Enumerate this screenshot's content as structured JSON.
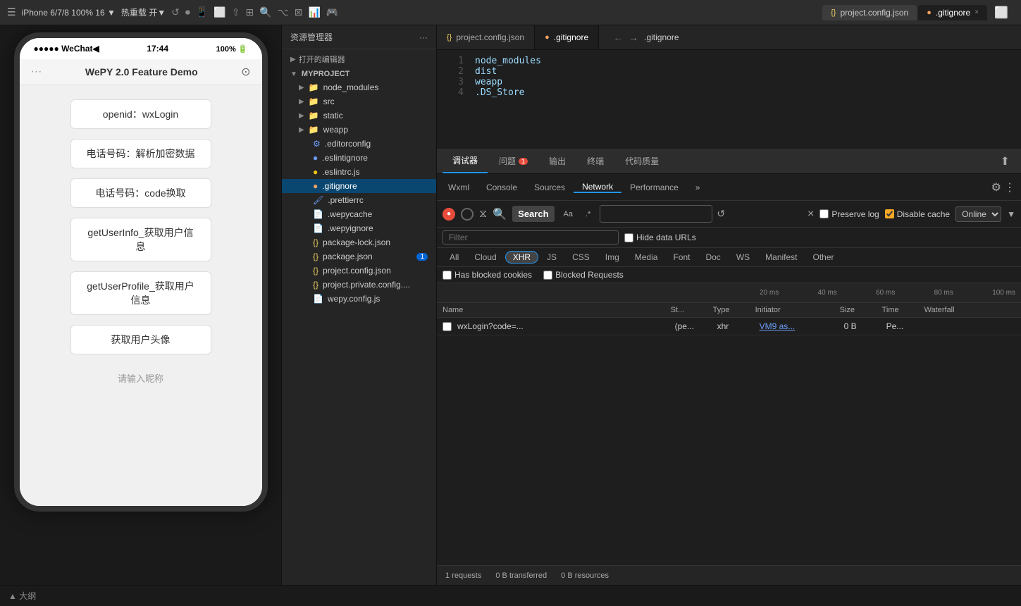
{
  "topbar": {
    "device_label": "iPhone 6/7/8 100% 16 ▼",
    "hotreload_label": "热重载 开▼",
    "tab_json": "project.config.json",
    "tab_gitignore": ".gitignore",
    "tab_gitignore_close": "×"
  },
  "explorer": {
    "header": "资源管理器",
    "open_editors": "打开的编辑器",
    "project": "MYPROJECT",
    "files": [
      {
        "name": "node_modules",
        "type": "folder",
        "indent": 1
      },
      {
        "name": "src",
        "type": "folder",
        "indent": 1
      },
      {
        "name": "static",
        "type": "folder",
        "indent": 1
      },
      {
        "name": "weapp",
        "type": "folder",
        "indent": 1
      },
      {
        "name": ".editorconfig",
        "type": "config",
        "indent": 1
      },
      {
        "name": ".eslintignore",
        "type": "config",
        "indent": 1
      },
      {
        "name": ".eslintrc.js",
        "type": "js",
        "indent": 1
      },
      {
        "name": ".gitignore",
        "type": "git",
        "indent": 1,
        "active": true
      },
      {
        "name": ".prettierrc",
        "type": "config",
        "indent": 1
      },
      {
        "name": ".wepycache",
        "type": "dot",
        "indent": 1
      },
      {
        "name": ".wepyignore",
        "type": "dot",
        "indent": 1
      },
      {
        "name": "package-lock.json",
        "type": "json",
        "indent": 1
      },
      {
        "name": "package.json",
        "type": "json",
        "indent": 1,
        "badge": "1"
      },
      {
        "name": "project.config.json",
        "type": "json",
        "indent": 1
      },
      {
        "name": "project.private.config....",
        "type": "json",
        "indent": 1
      },
      {
        "name": "wepy.config.js",
        "type": "js",
        "indent": 1
      }
    ]
  },
  "editor": {
    "tabs": [
      {
        "name": "project.config.json",
        "type": "json"
      },
      {
        "name": ".gitignore",
        "type": "git",
        "active": true
      }
    ],
    "breadcrumb": ".gitignore",
    "lines": [
      {
        "num": 1,
        "text": "node_modules"
      },
      {
        "num": 2,
        "text": "dist"
      },
      {
        "num": 3,
        "text": "weapp"
      },
      {
        "num": 4,
        "text": ".DS_Store"
      }
    ]
  },
  "devtools": {
    "tabs": [
      {
        "name": "调试器",
        "active": true
      },
      {
        "name": "问题",
        "badge": "1"
      },
      {
        "name": "输出"
      },
      {
        "name": "终端"
      },
      {
        "name": "代码质量"
      }
    ],
    "network_tabs": [
      {
        "name": "Wxml"
      },
      {
        "name": "Console"
      },
      {
        "name": "Sources"
      },
      {
        "name": "Network",
        "active": true
      },
      {
        "name": "Performance"
      },
      {
        "name": "»"
      }
    ],
    "search": {
      "label": "Search",
      "placeholder": "",
      "opts": [
        "Aa",
        ".*"
      ],
      "close": "×"
    },
    "toolbar": {
      "record_active": true,
      "preserve_log": false,
      "disable_cache": true,
      "online_label": "Online",
      "filter_placeholder": "Filter",
      "hide_data_urls": false
    },
    "type_filters": [
      {
        "label": "All"
      },
      {
        "label": "Cloud"
      },
      {
        "label": "XHR",
        "active": true
      },
      {
        "label": "JS"
      },
      {
        "label": "CSS"
      },
      {
        "label": "Img"
      },
      {
        "label": "Media"
      },
      {
        "label": "Font"
      },
      {
        "label": "Doc"
      },
      {
        "label": "WS"
      },
      {
        "label": "Manifest"
      },
      {
        "label": "Other"
      }
    ],
    "block_filters": [
      {
        "label": "Has blocked cookies",
        "checked": false
      },
      {
        "label": "Blocked Requests",
        "checked": false
      }
    ],
    "timeline": {
      "markers": [
        "20 ms",
        "40 ms",
        "60 ms",
        "80 ms",
        "100 ms"
      ]
    },
    "table": {
      "headers": [
        "Name",
        "St...",
        "Type",
        "Initiator",
        "Size",
        "Time",
        "Waterfall"
      ],
      "rows": [
        {
          "name": "wxLogin?code=...",
          "status": "(pe...",
          "type": "xhr",
          "initiator": "VM9 as...",
          "size": "0 B",
          "time": "Pe..."
        }
      ]
    },
    "statusbar": {
      "requests": "1 requests",
      "transferred": "0 B transferred",
      "resources": "0 B resources"
    }
  },
  "phone": {
    "carrier": "●●●●● WeChat◀",
    "time": "17:44",
    "battery": "100% 🔋",
    "title": "WePY 2.0 Feature Demo",
    "openid": "openid：wxLogin",
    "btn1": "电话号码：解析加密数据",
    "btn2": "电话号码：code换取",
    "btn3": "getUserInfo_获取用户信息",
    "btn4": "getUserProfile_获取用户信息",
    "btn5": "获取用户头像",
    "placeholder": "请输入昵称"
  },
  "bottom": {
    "expand_label": "▲ 大纲"
  }
}
